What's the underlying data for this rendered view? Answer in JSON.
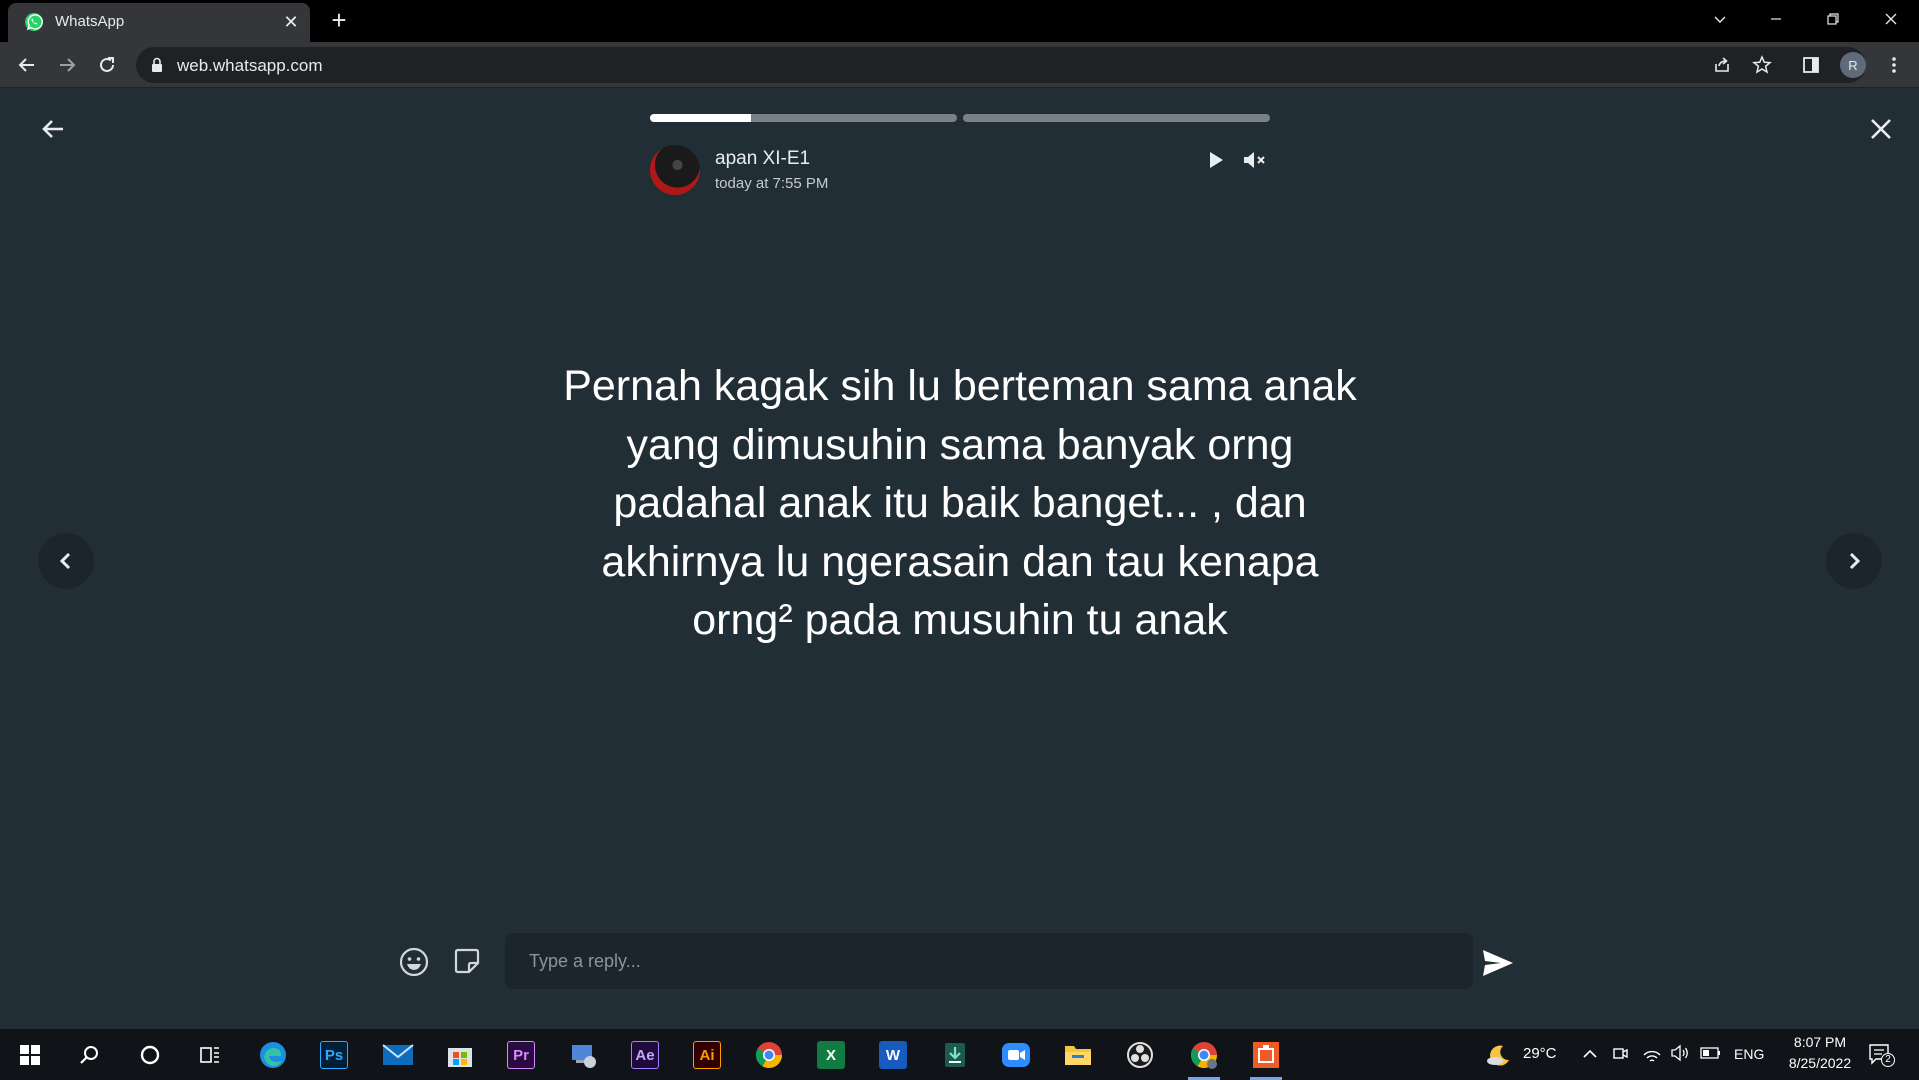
{
  "browser": {
    "tab_title": "WhatsApp",
    "tab_close_glyph": "✕",
    "new_tab_glyph": "+",
    "url": "web.whatsapp.com",
    "profile_initial": "R"
  },
  "status": {
    "contact_name": "apan XI-E1",
    "timestamp": "today at 7:55 PM",
    "text": "Pernah kagak sih lu berteman sama anak yang dimusuhin sama banyak orng padahal anak itu baik banget... , dan akhirnya lu ngerasain dan tau kenapa orng² pada musuhin tu anak",
    "segments": [
      {
        "progress": 0.33
      },
      {
        "progress": 0
      },
      {
        "progress": 0
      }
    ]
  },
  "reply": {
    "placeholder": "Type a reply..."
  },
  "taskbar": {
    "apps": [
      {
        "name": "start",
        "label": ""
      },
      {
        "name": "search",
        "label": ""
      },
      {
        "name": "cortana",
        "label": ""
      },
      {
        "name": "task-view",
        "label": ""
      },
      {
        "name": "edge",
        "label": ""
      },
      {
        "name": "photoshop",
        "label": "Ps"
      },
      {
        "name": "mail",
        "label": ""
      },
      {
        "name": "store",
        "label": ""
      },
      {
        "name": "premiere",
        "label": "Pr"
      },
      {
        "name": "control-panel",
        "label": ""
      },
      {
        "name": "after-effects",
        "label": "Ae"
      },
      {
        "name": "illustrator",
        "label": "Ai"
      },
      {
        "name": "chrome",
        "label": ""
      },
      {
        "name": "excel",
        "label": "X"
      },
      {
        "name": "word",
        "label": "W"
      },
      {
        "name": "downloader",
        "label": ""
      },
      {
        "name": "zoom",
        "label": ""
      },
      {
        "name": "file-explorer",
        "label": ""
      },
      {
        "name": "obs",
        "label": ""
      },
      {
        "name": "chrome-profile",
        "label": ""
      },
      {
        "name": "powerpoint-like",
        "label": ""
      }
    ],
    "weather": "29°C",
    "language": "ENG",
    "time": "8:07 PM",
    "date": "8/25/2022",
    "notifications": "2"
  },
  "colors": {
    "viewer_bg": "#222e35",
    "accent_whatsapp": "#25d366",
    "taskbar_bg": "#101418"
  }
}
